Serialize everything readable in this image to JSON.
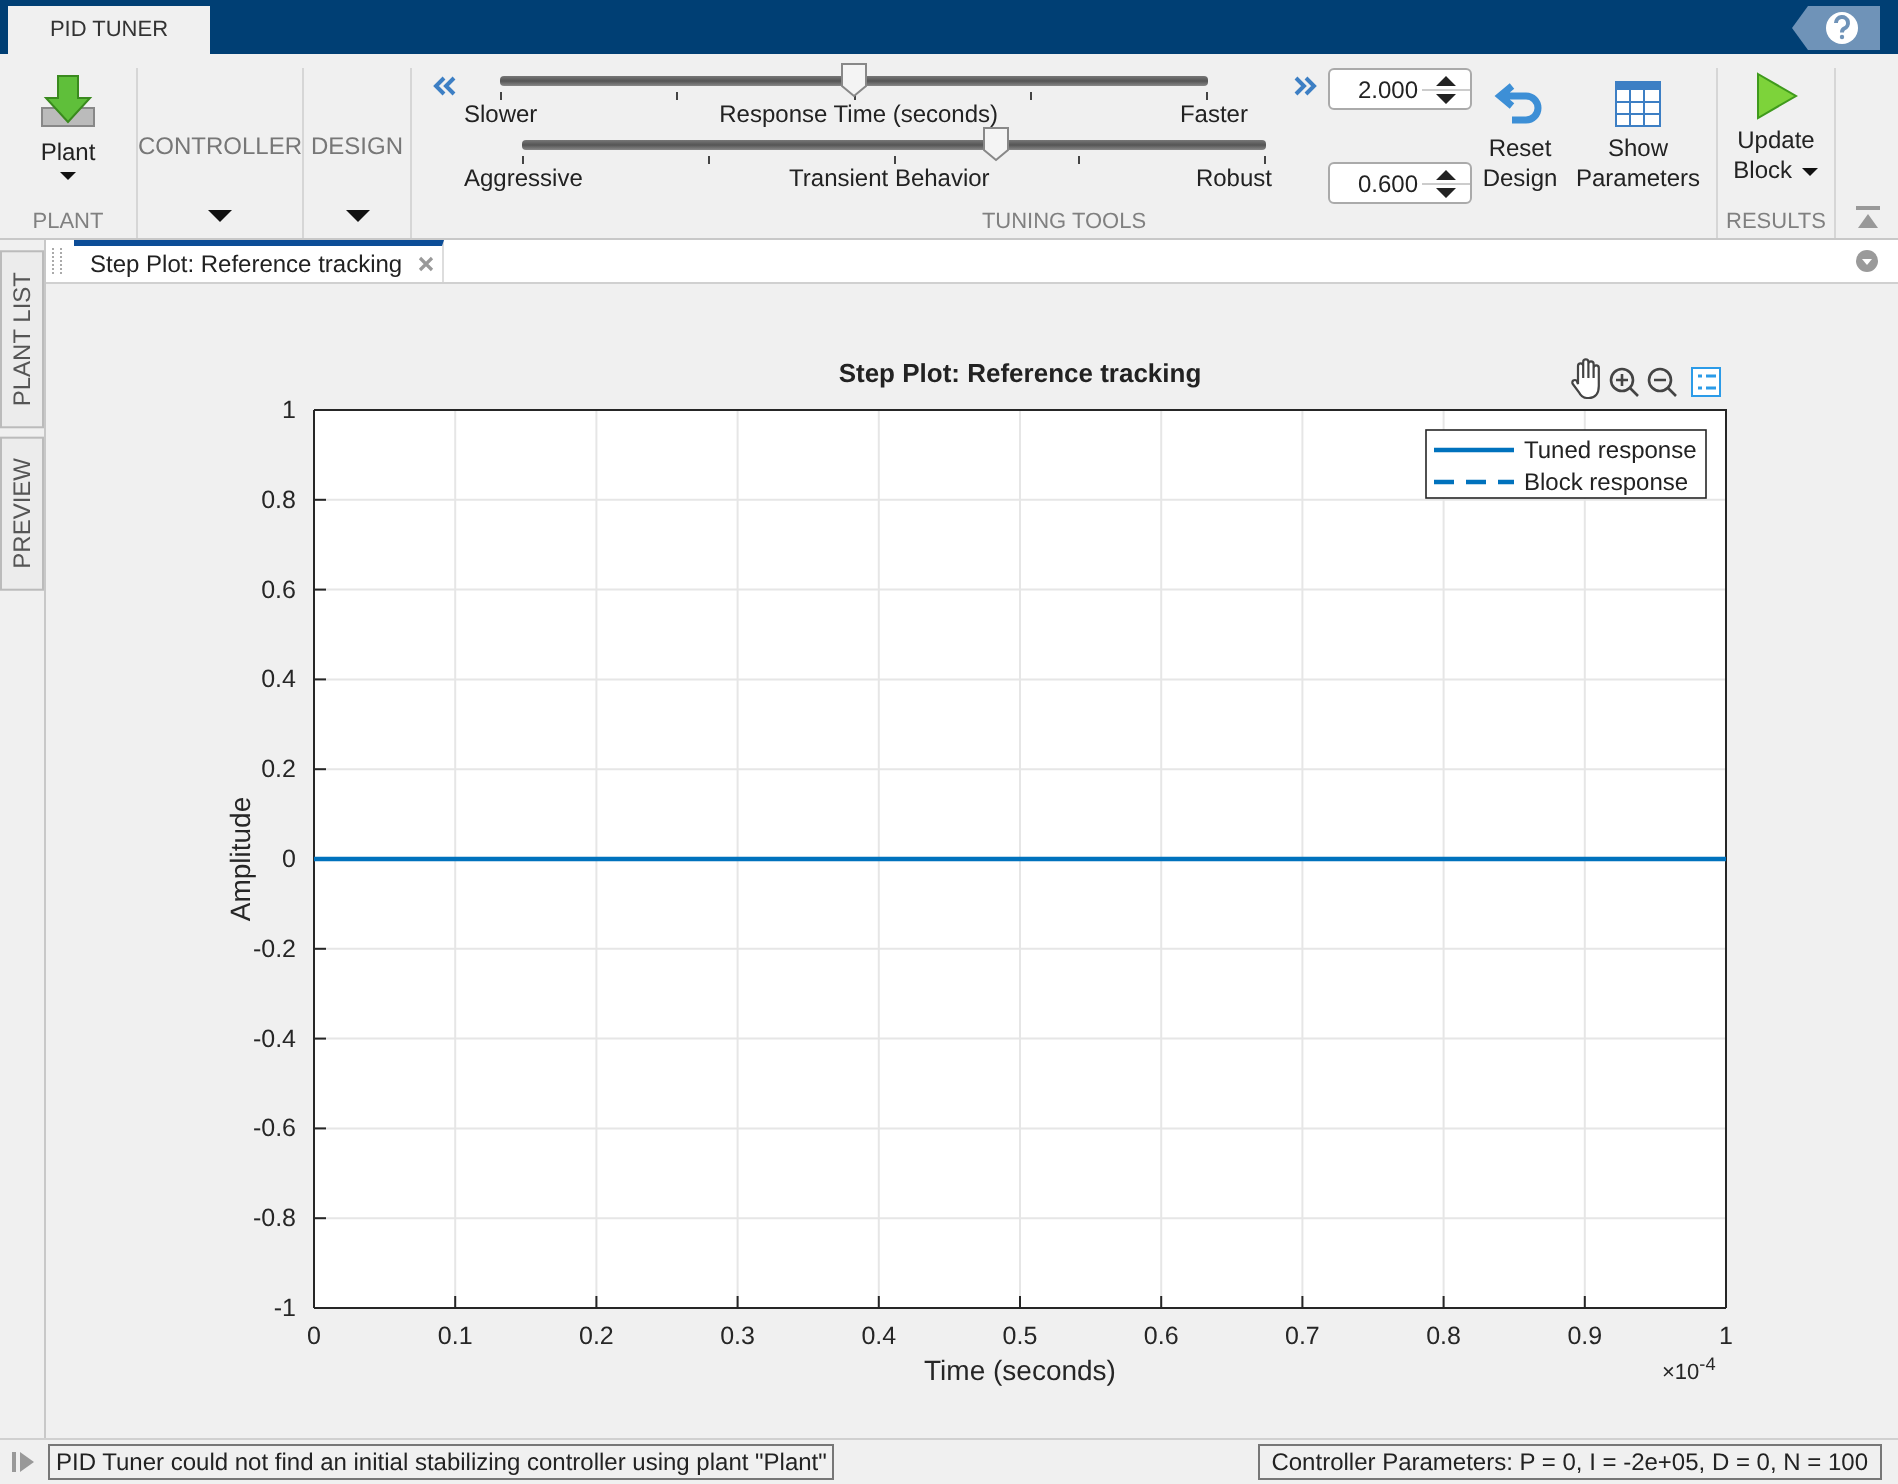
{
  "title_bar": {
    "tabs": [
      {
        "label": "PID TUNER",
        "selected": true
      }
    ]
  },
  "toolstrip": {
    "plant": {
      "button": "Plant",
      "section": "PLANT"
    },
    "controller": {
      "section": "CONTROLLER"
    },
    "design": {
      "section": "DESIGN"
    },
    "tuning_tools": {
      "section": "TUNING TOOLS",
      "sliders": [
        {
          "left": "Slower",
          "center": "Response Time (seconds)",
          "right": "Faster",
          "level": 0.5,
          "value": "2.000"
        },
        {
          "left": "Aggressive",
          "center": "Transient Behavior",
          "right": "Robust",
          "level": 0.637,
          "value": "0.600"
        }
      ],
      "buttons": [
        {
          "kind": "reset",
          "label": "Reset Design"
        },
        {
          "kind": "table",
          "label": "Show Parameters"
        }
      ]
    },
    "results": {
      "section": "RESULTS",
      "button": "Update Block"
    }
  },
  "side_tabs": [
    "PLANT LIST",
    "PREVIEW"
  ],
  "document_tabs": [
    {
      "label": "Step Plot: Reference tracking",
      "selected": true
    }
  ],
  "plot": {
    "x_exponent": "×10$^{-4}$",
    "chart_data": {
      "type": "line",
      "title": "Step Plot: Reference tracking",
      "xlabel": "Time (seconds)",
      "ylabel": "Amplitude",
      "x": [
        0,
        1
      ],
      "series": [
        {
          "name": "Tuned response",
          "color": "#0072bd",
          "line_style": "solid",
          "values": [
            0,
            0
          ]
        },
        {
          "name": "Block response",
          "color": "#0072bd",
          "line_style": "dashed",
          "values": [
            null,
            null
          ]
        }
      ],
      "grid": true,
      "legend": true,
      "xlim": [
        0,
        1
      ],
      "ylim": [
        -1,
        1
      ],
      "xticks": [
        0,
        0.1,
        0.2,
        0.3,
        0.4,
        0.5,
        0.6,
        0.7,
        0.8,
        0.9,
        1
      ],
      "yticks": [
        -1,
        -0.8,
        -0.6,
        -0.4,
        -0.2,
        0,
        0.2,
        0.4,
        0.6,
        0.8,
        1
      ]
    }
  },
  "status_bar": {
    "message": "PID Tuner could not find an initial stabilizing controller using plant \"Plant\"",
    "parameters": "Controller Parameters: P =  0, I = -2e+05, D =  0, N = 100"
  }
}
